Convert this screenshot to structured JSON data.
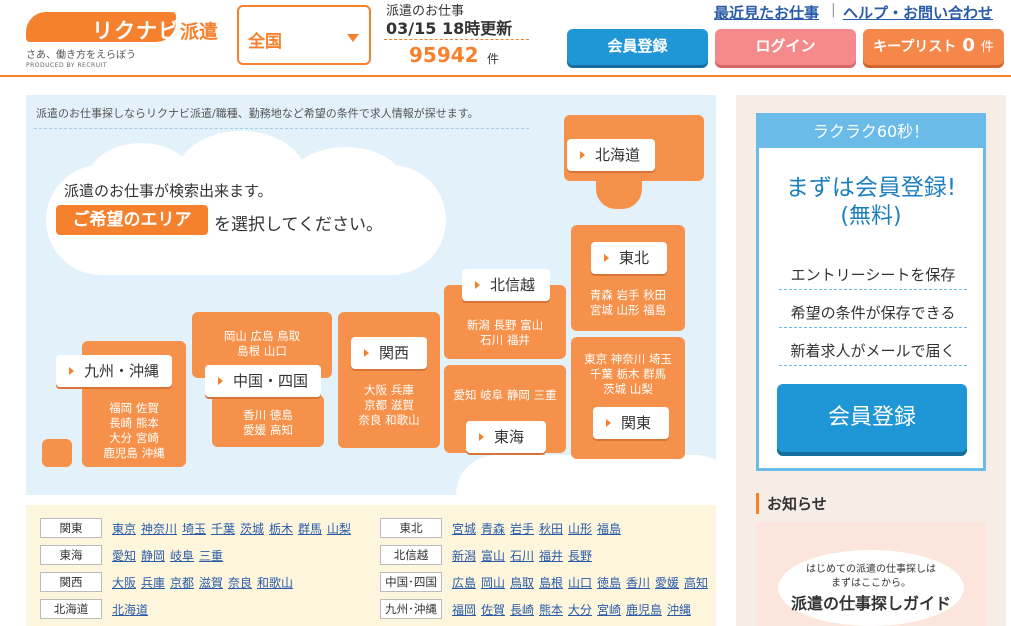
{
  "header": {
    "logo_text": "リクナビ",
    "logo_suffix": "派遣",
    "tagline": "さあ、働き方をえらぼう",
    "produced_by": "PRODUCED BY RECRUIT",
    "area_select": "全国",
    "jobs_label": "派遣のお仕事",
    "jobs_updated": "03/15 18時更新",
    "jobs_count": "95942",
    "jobs_unit": "件",
    "link_recent": "最近見たお仕事",
    "link_help": "ヘルプ・お問い合わせ",
    "separator": "|",
    "btn_register": "会員登録",
    "btn_login": "ログイン",
    "btn_keep": "キープリスト",
    "keep_count": "0",
    "keep_unit": "件",
    "accent": "#f5812e"
  },
  "map": {
    "intro": "派遣のお仕事探しならリクナビ派遣/職種、勤務地など希望の条件で求人情報が探せます。",
    "bubble_line1": "派遣のお仕事が検索出来ます。",
    "bubble_highlight": "ご希望のエリア",
    "bubble_line2": "を選択してください。",
    "regions": {
      "hokkaido": {
        "label": "北海道"
      },
      "tohoku": {
        "label": "東北",
        "prefs1": "青森 岩手 秋田",
        "prefs2": "宮城 山形 福島"
      },
      "kanto": {
        "label": "関東",
        "prefs1": "東京 神奈川 埼玉",
        "prefs2": "千葉 栃木 群馬",
        "prefs3": "茨城 山梨"
      },
      "hokushinetsu": {
        "label": "北信越",
        "prefs1": "新潟 長野 富山",
        "prefs2": "石川 福井"
      },
      "tokai": {
        "label": "東海",
        "prefs1": "愛知 岐阜 静岡 三重"
      },
      "kansai": {
        "label": "関西",
        "prefs1": "大阪 兵庫",
        "prefs2": "京都 滋賀",
        "prefs3": "奈良 和歌山"
      },
      "chugoku": {
        "label": "中国・四国",
        "prefs1": "岡山 広島 鳥取",
        "prefs2": "島根 山口",
        "prefs3": "香川 徳島",
        "prefs4": "愛媛 高知"
      },
      "kyushu": {
        "label": "九州・沖縄",
        "prefs1": "福岡 佐賀",
        "prefs2": "長崎 熊本",
        "prefs3": "大分 宮崎",
        "prefs4": "鹿児島 沖縄"
      }
    }
  },
  "quick": {
    "left": [
      {
        "label": "関東",
        "links": [
          "東京",
          "神奈川",
          "埼玉",
          "千葉",
          "茨城",
          "栃木",
          "群馬",
          "山梨"
        ]
      },
      {
        "label": "東海",
        "links": [
          "愛知",
          "静岡",
          "岐阜",
          "三重"
        ]
      },
      {
        "label": "関西",
        "links": [
          "大阪",
          "兵庫",
          "京都",
          "滋賀",
          "奈良",
          "和歌山"
        ]
      },
      {
        "label": "北海道",
        "links": [
          "北海道"
        ]
      }
    ],
    "right": [
      {
        "label": "東北",
        "links": [
          "宮城",
          "青森",
          "岩手",
          "秋田",
          "山形",
          "福島"
        ]
      },
      {
        "label": "北信越",
        "links": [
          "新潟",
          "富山",
          "石川",
          "福井",
          "長野"
        ]
      },
      {
        "label": "中国･四国",
        "links": [
          "広島",
          "岡山",
          "鳥取",
          "島根",
          "山口",
          "徳島",
          "香川",
          "愛媛",
          "高知"
        ]
      },
      {
        "label": "九州･沖縄",
        "links": [
          "福岡",
          "佐賀",
          "長崎",
          "熊本",
          "大分",
          "宮崎",
          "鹿児島",
          "沖縄"
        ]
      }
    ]
  },
  "sidebar": {
    "banner_top": "ラクラク60秒！",
    "title1": "まずは会員登録!",
    "title2": "(無料)",
    "features": [
      "エントリーシートを保存",
      "希望の条件が保存できる",
      "新着求人がメールで届く"
    ],
    "register_button": "会員登録",
    "news_heading": "お知らせ",
    "guide_line1": "はじめての派遣の仕事探しは",
    "guide_line2": "まずはここから。",
    "guide_title": "派遣の仕事探しガイド"
  }
}
